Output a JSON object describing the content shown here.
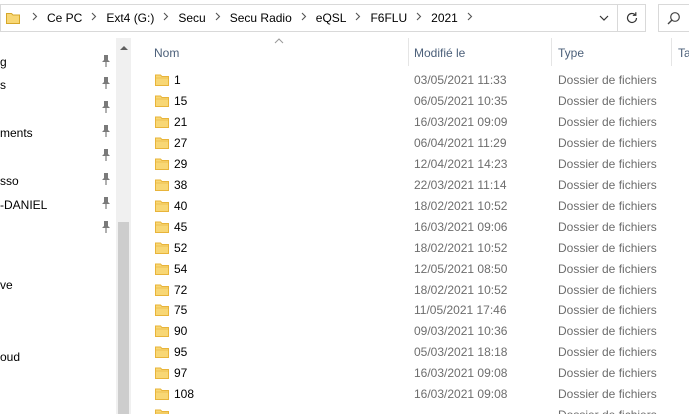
{
  "breadcrumb": [
    "Ce PC",
    "Ext4 (G:)",
    "Secu",
    "Secu Radio",
    "eQSL",
    "F6FLU",
    "2021"
  ],
  "nav": {
    "items": [
      {
        "label": "g",
        "pinned": true
      },
      {
        "label": "s",
        "pinned": true
      },
      {
        "label": "ments",
        "pinned": true
      },
      {
        "label": "",
        "pinned": true
      },
      {
        "label": "sso",
        "pinned": true
      },
      {
        "label": "-DANIEL",
        "pinned": true
      },
      {
        "label": "",
        "pinned": true
      },
      {
        "label": "ve",
        "pinned": false
      },
      {
        "label": "oud",
        "pinned": false
      }
    ]
  },
  "columns": {
    "name": "Nom",
    "modified": "Modifié le",
    "type": "Type",
    "size": "Ta"
  },
  "files": [
    {
      "name": "1",
      "modified": "03/05/2021 11:33",
      "type": "Dossier de fichiers"
    },
    {
      "name": "15",
      "modified": "06/05/2021 10:35",
      "type": "Dossier de fichiers"
    },
    {
      "name": "21",
      "modified": "16/03/2021 09:09",
      "type": "Dossier de fichiers"
    },
    {
      "name": "27",
      "modified": "06/04/2021 11:29",
      "type": "Dossier de fichiers"
    },
    {
      "name": "29",
      "modified": "12/04/2021 14:23",
      "type": "Dossier de fichiers"
    },
    {
      "name": "38",
      "modified": "22/03/2021 11:14",
      "type": "Dossier de fichiers"
    },
    {
      "name": "40",
      "modified": "18/02/2021 10:52",
      "type": "Dossier de fichiers"
    },
    {
      "name": "45",
      "modified": "16/03/2021 09:06",
      "type": "Dossier de fichiers"
    },
    {
      "name": "52",
      "modified": "18/02/2021 10:52",
      "type": "Dossier de fichiers"
    },
    {
      "name": "54",
      "modified": "12/05/2021 08:50",
      "type": "Dossier de fichiers"
    },
    {
      "name": "72",
      "modified": "18/02/2021 10:52",
      "type": "Dossier de fichiers"
    },
    {
      "name": "75",
      "modified": "11/05/2021 17:46",
      "type": "Dossier de fichiers"
    },
    {
      "name": "90",
      "modified": "09/03/2021 10:36",
      "type": "Dossier de fichiers"
    },
    {
      "name": "95",
      "modified": "05/03/2021 18:18",
      "type": "Dossier de fichiers"
    },
    {
      "name": "97",
      "modified": "16/03/2021 09:08",
      "type": "Dossier de fichiers"
    },
    {
      "name": "108",
      "modified": "16/03/2021 09:08",
      "type": "Dossier de fichiers"
    },
    {
      "name": "",
      "modified": "",
      "type": "Dossier de fichiers"
    }
  ],
  "colors": {
    "folder": "#f8d775",
    "folder_dark": "#e8b43a",
    "header_text": "#4c607a",
    "secondary_text": "#6d6d6d"
  },
  "icons": {
    "address_folder": "folder-icon",
    "dropdown": "chevron-down-icon",
    "refresh": "refresh-icon",
    "search": "search-icon",
    "pin": "pin-icon",
    "sort": "sort-up-icon",
    "row_folder": "folder-icon"
  }
}
